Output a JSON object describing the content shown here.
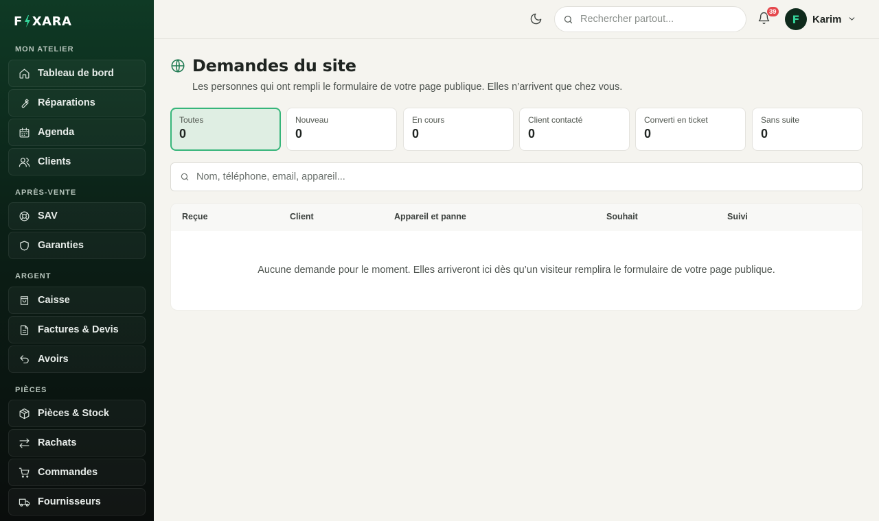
{
  "brand": {
    "left": "F",
    "right": "XARA"
  },
  "sidebar": {
    "sections": [
      {
        "label": "MON ATELIER",
        "items": [
          {
            "label": "Tableau de bord",
            "icon": "home-icon"
          },
          {
            "label": "Réparations",
            "icon": "wrench-icon"
          },
          {
            "label": "Agenda",
            "icon": "calendar-icon"
          },
          {
            "label": "Clients",
            "icon": "users-icon"
          }
        ]
      },
      {
        "label": "APRÈS-VENTE",
        "items": [
          {
            "label": "SAV",
            "icon": "lifebuoy-icon"
          },
          {
            "label": "Garanties",
            "icon": "shield-icon"
          }
        ]
      },
      {
        "label": "ARGENT",
        "items": [
          {
            "label": "Caisse",
            "icon": "register-icon"
          },
          {
            "label": "Factures & Devis",
            "icon": "document-icon"
          },
          {
            "label": "Avoirs",
            "icon": "undo-icon"
          }
        ]
      },
      {
        "label": "PIÈCES",
        "items": [
          {
            "label": "Pièces & Stock",
            "icon": "package-icon"
          },
          {
            "label": "Rachats",
            "icon": "swap-icon"
          },
          {
            "label": "Commandes",
            "icon": "cart-icon"
          },
          {
            "label": "Fournisseurs",
            "icon": "truck-icon"
          }
        ]
      }
    ]
  },
  "topbar": {
    "search_placeholder": "Rechercher partout...",
    "notifications_count": "39",
    "user_initial": "F",
    "user_name": "Karim"
  },
  "page": {
    "title": "Demandes du site",
    "subtitle": "Les personnes qui ont rempli le formulaire de votre page publique. Elles n’arrivent que chez vous.",
    "stats": [
      {
        "label": "Toutes",
        "value": "0",
        "active": true
      },
      {
        "label": "Nouveau",
        "value": "0"
      },
      {
        "label": "En cours",
        "value": "0"
      },
      {
        "label": "Client contacté",
        "value": "0"
      },
      {
        "label": "Converti en ticket",
        "value": "0"
      },
      {
        "label": "Sans suite",
        "value": "0"
      }
    ],
    "filter_placeholder": "Nom, téléphone, email, appareil...",
    "table": {
      "columns": [
        "Reçue",
        "Client",
        "Appareil et panne",
        "Souhait",
        "Suivi"
      ],
      "empty_message": "Aucune demande pour le moment. Elles arriveront ici dès qu’un visiteur remplira le formulaire de votre page publique."
    }
  },
  "colors": {
    "accent": "#1f7a52",
    "active_bg": "#dfeee3",
    "active_border": "#36b57a",
    "badge": "#e5484d"
  }
}
